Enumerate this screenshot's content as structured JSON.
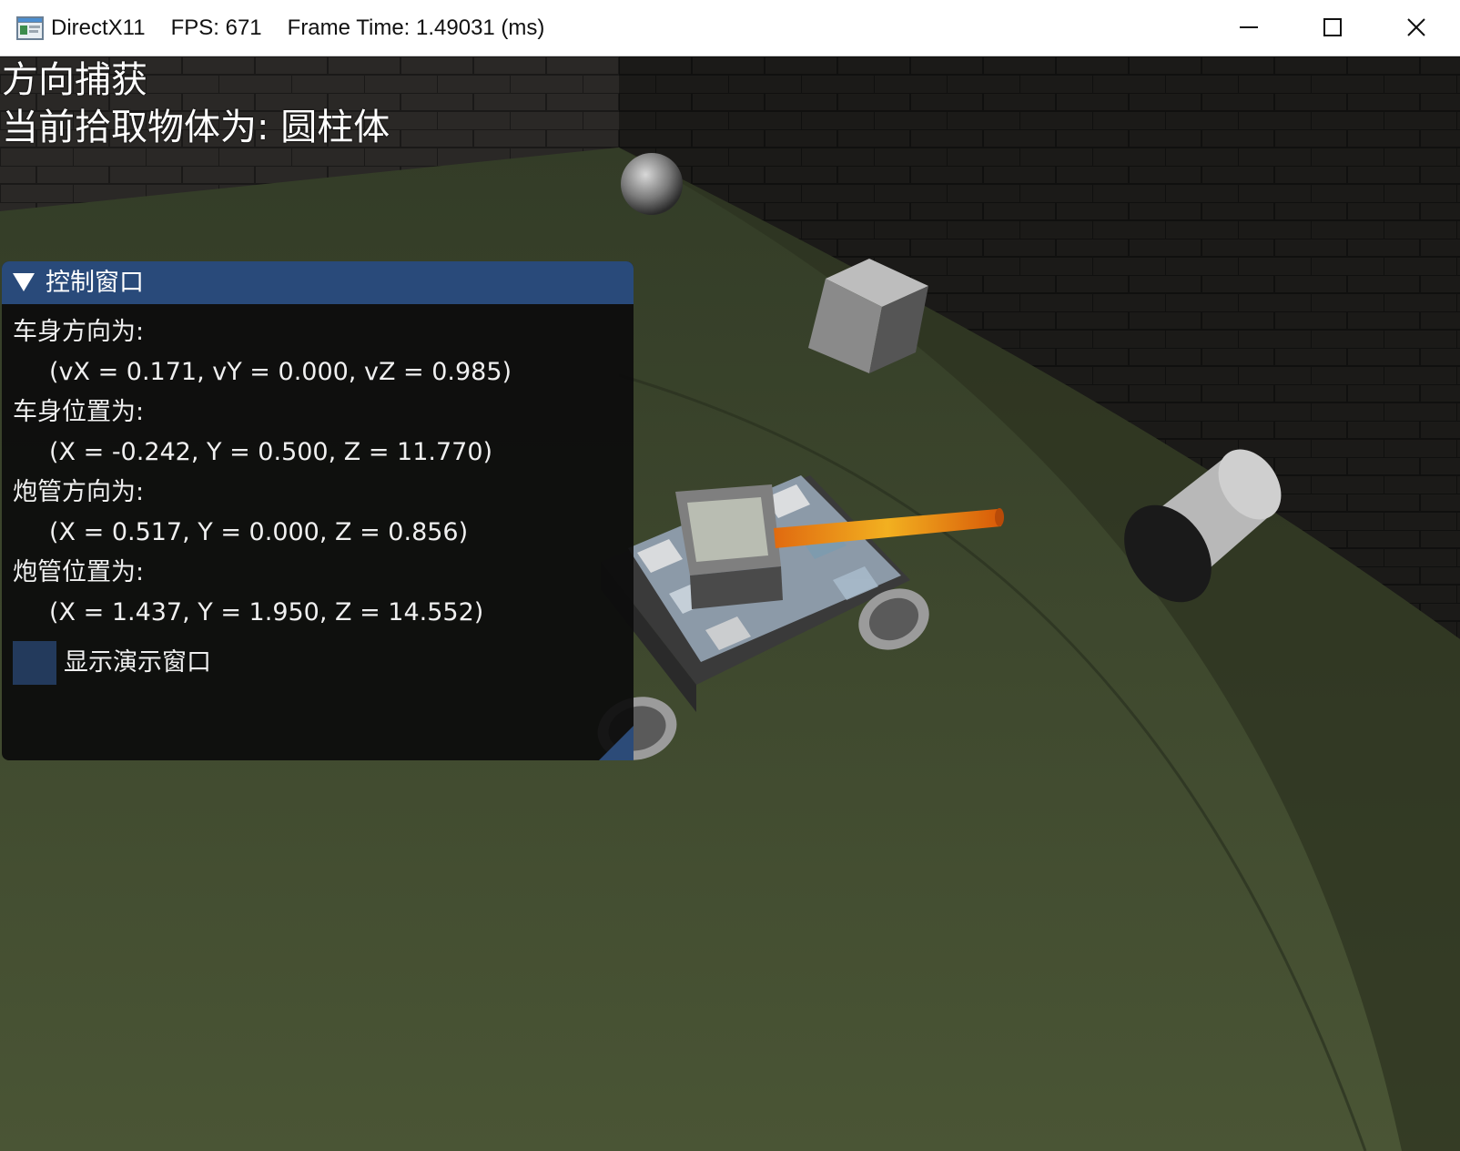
{
  "window": {
    "title": "DirectX11",
    "fps": "FPS: 671",
    "frame_time": "Frame Time: 1.49031 (ms)",
    "controls": {
      "minimize_icon": "minimize-icon",
      "maximize_icon": "maximize-icon",
      "close_icon": "close-icon"
    }
  },
  "overlay": {
    "mode": "方向捕获",
    "picked_object": "当前拾取物体为: 圆柱体"
  },
  "panel": {
    "title": "控制窗口",
    "body_direction_label": "车身方向为:",
    "body_direction_value": "(vX = 0.171, vY = 0.000, vZ = 0.985)",
    "body_position_label": "车身位置为:",
    "body_position_value": "(X = -0.242, Y = 0.500, Z = 11.770)",
    "barrel_direction_label": "炮管方向为:",
    "barrel_direction_value": "(X = 0.517, Y = 0.000, Z = 0.856)",
    "barrel_position_label": "炮管位置为:",
    "barrel_position_value": "(X = 1.437, Y = 1.950, Z = 14.552)",
    "checkbox_label": "显示演示窗口",
    "checkbox_checked": false
  },
  "colors": {
    "panel_header": "#294a7a",
    "checkbox": "#233a5c",
    "panel_bg": "#0c0c0c",
    "ground": "#3f4a2e",
    "wall": "#2a2826"
  }
}
